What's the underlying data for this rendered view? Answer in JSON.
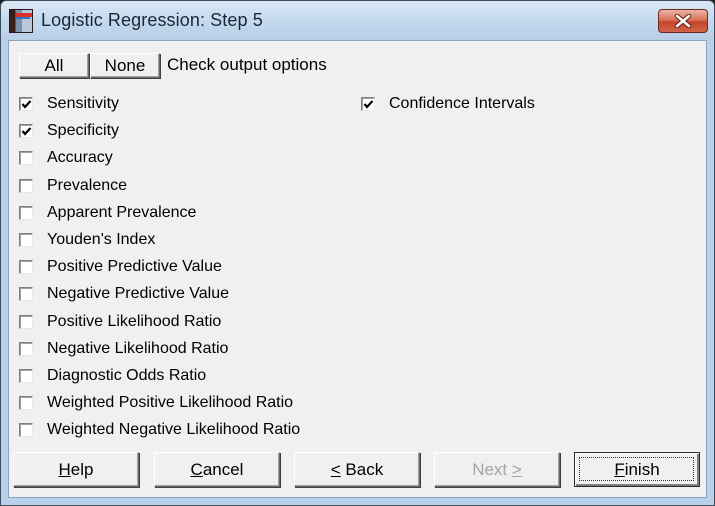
{
  "window": {
    "title": "Logistic Regression: Step 5",
    "app_icon": "application-icon",
    "close_icon": "close-icon"
  },
  "toolbar": {
    "all_label": "All",
    "none_label": "None",
    "hint": "Check output options"
  },
  "options_left": [
    {
      "label": "Sensitivity",
      "checked": true
    },
    {
      "label": "Specificity",
      "checked": true
    },
    {
      "label": "Accuracy",
      "checked": false
    },
    {
      "label": "Prevalence",
      "checked": false
    },
    {
      "label": "Apparent Prevalence",
      "checked": false
    },
    {
      "label": "Youden's Index",
      "checked": false
    },
    {
      "label": "Positive Predictive Value",
      "checked": false
    },
    {
      "label": "Negative Predictive Value",
      "checked": false
    },
    {
      "label": "Positive Likelihood Ratio",
      "checked": false
    },
    {
      "label": "Negative Likelihood Ratio",
      "checked": false
    },
    {
      "label": "Diagnostic Odds Ratio",
      "checked": false
    },
    {
      "label": "Weighted Positive Likelihood Ratio",
      "checked": false
    },
    {
      "label": "Weighted Negative Likelihood Ratio",
      "checked": false
    }
  ],
  "options_right": [
    {
      "label": "Confidence Intervals",
      "checked": true
    }
  ],
  "footer": {
    "help": {
      "mnemonic": "H",
      "rest": "elp"
    },
    "cancel": {
      "mnemonic": "C",
      "rest": "ancel"
    },
    "back": {
      "mnemonic": "<",
      "rest": " Back"
    },
    "next": {
      "pre": "Next ",
      "mnemonic": ">"
    },
    "finish": {
      "mnemonic": "F",
      "rest": "inish"
    },
    "next_disabled": true,
    "default_button": "finish"
  }
}
